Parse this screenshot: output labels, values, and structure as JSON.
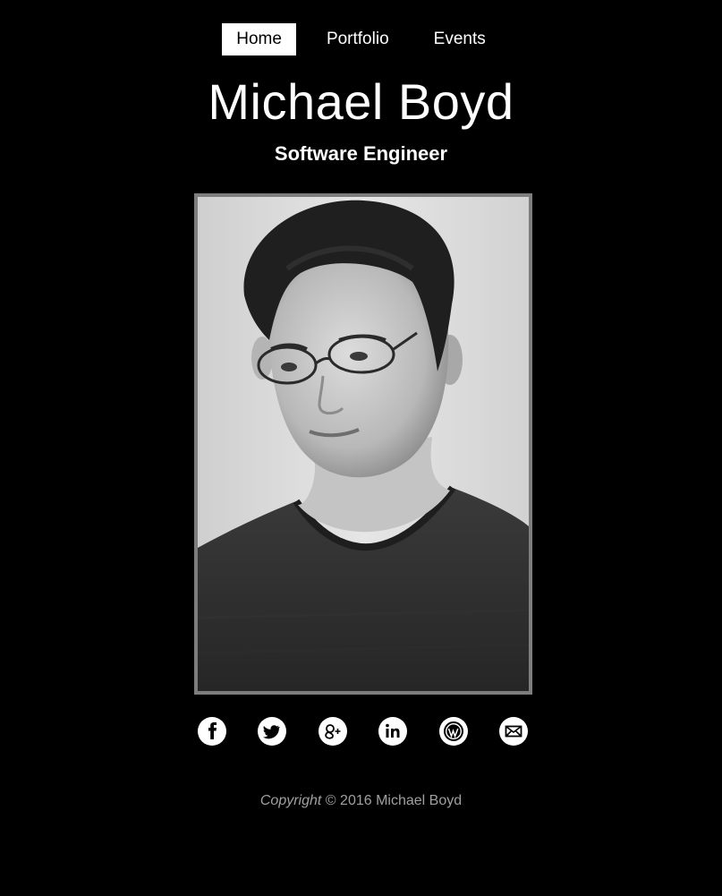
{
  "nav": {
    "items": [
      {
        "label": "Home",
        "active": true
      },
      {
        "label": "Portfolio",
        "active": false
      },
      {
        "label": "Events",
        "active": false
      }
    ]
  },
  "header": {
    "name": "Michael Boyd",
    "role": "Software Engineer"
  },
  "social": [
    {
      "icon": "facebook-icon"
    },
    {
      "icon": "twitter-icon"
    },
    {
      "icon": "google-plus-icon"
    },
    {
      "icon": "linkedin-icon"
    },
    {
      "icon": "wordpress-icon"
    },
    {
      "icon": "email-icon"
    }
  ],
  "footer": {
    "copyright_word": "Copyright",
    "copyright_rest": " © 2016 Michael Boyd"
  },
  "colors": {
    "background": "#000000",
    "text": "#ffffff",
    "footer_text": "#a0a0a0",
    "frame_border": "#7d7d7d"
  }
}
